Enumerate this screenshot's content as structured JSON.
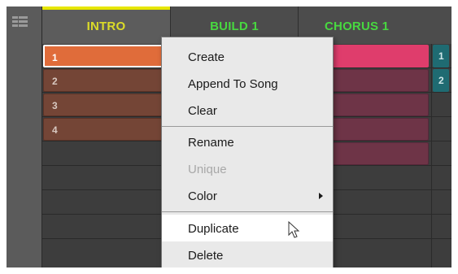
{
  "scenes": [
    {
      "label": "INTRO",
      "active": true
    },
    {
      "label": "BUILD 1",
      "active": false
    },
    {
      "label": "CHORUS 1",
      "active": false
    }
  ],
  "intro_clips": [
    "1",
    "2",
    "3",
    "4"
  ],
  "right_clips": [
    "1",
    "2"
  ],
  "menu": {
    "create": "Create",
    "append": "Append To Song",
    "clear": "Clear",
    "rename": "Rename",
    "unique": "Unique",
    "color": "Color",
    "duplicate": "Duplicate",
    "delete": "Delete"
  },
  "colors": {
    "scene_yellow": "#dcdc28",
    "scene_green": "#48d840",
    "intro_clip": "#e06c3a",
    "chorus_clip": "#df3d6c",
    "teal_clip": "#1f6b72"
  },
  "icons": [
    "grid-view-icon",
    "submenu-arrow-icon",
    "mouse-pointer-icon"
  ]
}
